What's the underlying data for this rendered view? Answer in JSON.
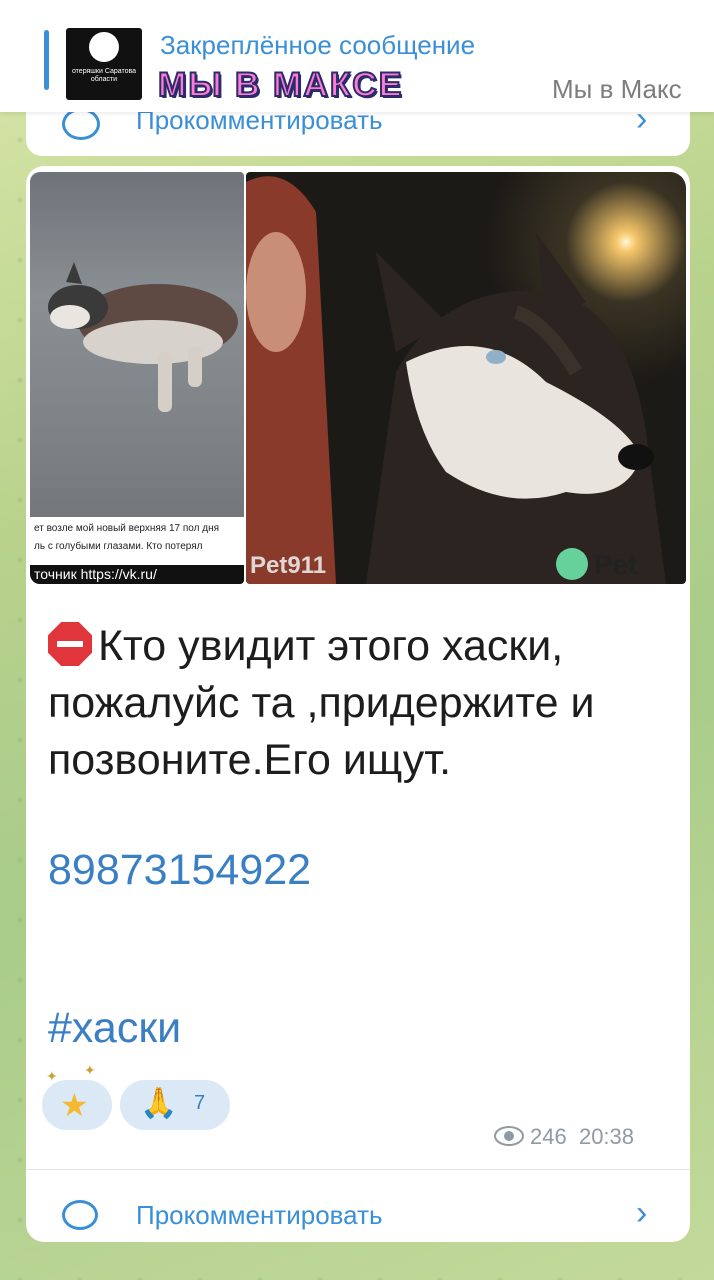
{
  "pinned": {
    "title": "Закреплённое сообщение",
    "logo_text": "МЫ В МАКСЕ",
    "preview": "Мы в Макс",
    "thumb_text": "отеряшки Саратова области"
  },
  "previous_message": {
    "comment_label": "Прокомментировать"
  },
  "message": {
    "photo1_caption_line1": "ет возле мой новый верхняя 17 пол дня",
    "photo1_caption_line2": "ль с голубыми глазами. Кто потерял",
    "photo1_source": "точник https://vk.ru/",
    "photo2_watermark": "Pet911",
    "photo2_logo": "Pet",
    "text": "Кто увидит этого хаски, пожалуйс та ,придержите и позвоните.Его ищут.",
    "phone": "89873154922",
    "hashtag": "#хаски",
    "reactions": [
      {
        "icon": "star-icon",
        "count": ""
      },
      {
        "icon": "praying-hands-icon",
        "count": "7"
      }
    ],
    "views": "246",
    "time": "20:38",
    "comment_label": "Прокомментировать"
  },
  "colors": {
    "accent": "#3a8fd6",
    "link": "#3a7fc4",
    "stop_sign": "#e0353b"
  }
}
